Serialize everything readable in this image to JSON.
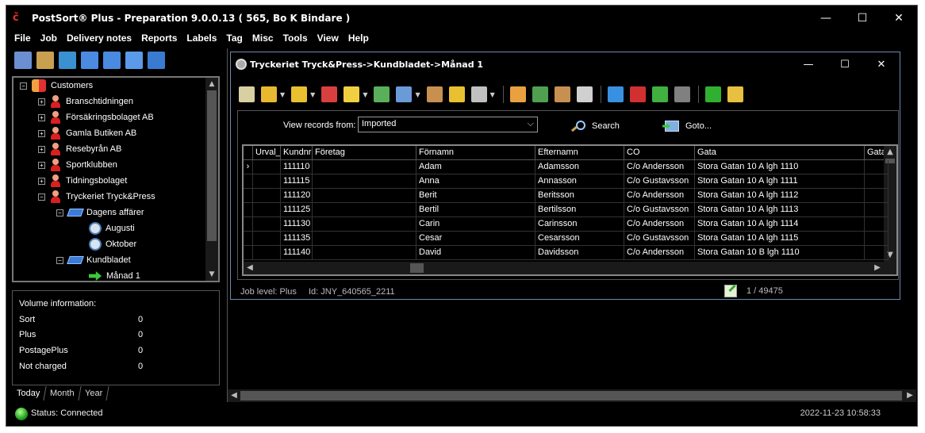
{
  "app": {
    "title": "PostSort® Plus - Preparation 9.0.0.13 ( 565, Bo K Bindare )",
    "logo_glyph": "ℂ"
  },
  "window_controls": {
    "minimize": "—",
    "maximize": "☐",
    "close": "✕"
  },
  "menu": [
    "File",
    "Job",
    "Delivery notes",
    "Reports",
    "Labels",
    "Tag",
    "Misc",
    "Tools",
    "View",
    "Help"
  ],
  "left_toolbar_icons": [
    {
      "name": "magnify-tools-icon",
      "color": "#6b8fd0"
    },
    {
      "name": "packages-icon",
      "color": "#c8a050"
    },
    {
      "name": "network-icon",
      "color": "#3a90d0"
    },
    {
      "name": "layout-columns-icon",
      "color": "#4a8ae0"
    },
    {
      "name": "layout-rows-icon",
      "color": "#4a8ae0"
    },
    {
      "name": "cascade-windows-icon",
      "color": "#5a9ae8"
    },
    {
      "name": "refresh-icon",
      "color": "#3a7ad0"
    }
  ],
  "tree": {
    "root": "Customers",
    "items": [
      {
        "label": "Branschtidningen"
      },
      {
        "label": "Försäkringsbolaget AB"
      },
      {
        "label": "Gamla Butiken AB"
      },
      {
        "label": "Resebyrån AB"
      },
      {
        "label": "Sportklubben"
      },
      {
        "label": "Tidningsbolaget"
      },
      {
        "label": "Tryckeriet Tryck&Press"
      }
    ],
    "sub1": "Dagens affärer",
    "sub1_children": [
      "Augusti",
      "Oktober"
    ],
    "sub2": "Kundbladet",
    "sub2_children": [
      "Månad 1"
    ],
    "expand_plus": "+",
    "expand_minus": "−"
  },
  "volume": {
    "title": "Volume information:",
    "rows": [
      {
        "label": "Sort",
        "value": "0"
      },
      {
        "label": "Plus",
        "value": "0"
      },
      {
        "label": "PostagePlus",
        "value": "0"
      },
      {
        "label": "Not charged",
        "value": "0"
      }
    ]
  },
  "tabs": [
    "Today",
    "Month",
    "Year"
  ],
  "status": {
    "text": "Status: Connected",
    "time": "2022-11-23 10:58:33"
  },
  "child": {
    "title": "Tryckeriet Tryck&Press->Kundbladet->Månad 1",
    "controls": {
      "minimize": "—",
      "maximize": "☐",
      "close": "✕"
    },
    "toolbar": [
      {
        "name": "edit-icon",
        "color": "#d8d0a0",
        "drop": false
      },
      {
        "name": "database-import-icon",
        "color": "#e8b830",
        "drop": true
      },
      {
        "name": "coins-icon",
        "color": "#e8c030",
        "drop": true
      },
      {
        "name": "pie-chart-icon",
        "color": "#d84040",
        "drop": false
      },
      {
        "name": "magic-wand-icon",
        "color": "#f0d040",
        "drop": true
      },
      {
        "name": "pen-write-icon",
        "color": "#5ab05a",
        "drop": false
      },
      {
        "name": "form-list-icon",
        "color": "#6a9ad8",
        "drop": true
      },
      {
        "name": "package-search-icon",
        "color": "#c89050",
        "drop": false
      },
      {
        "name": "database-filter-icon",
        "color": "#e8c030",
        "drop": false
      },
      {
        "name": "printer-icon",
        "color": "#c0c0c0",
        "drop": true
      },
      {
        "sep": true
      },
      {
        "name": "spreadsheet-icon",
        "color": "#e8a040",
        "drop": false
      },
      {
        "name": "gear-network-icon",
        "color": "#50a050",
        "drop": false
      },
      {
        "name": "package-export-icon",
        "color": "#c89050",
        "drop": false
      },
      {
        "name": "hand-icon",
        "color": "#d0d0d0",
        "drop": false
      },
      {
        "sep": true
      },
      {
        "name": "arrow-up-right-icon",
        "color": "#3a90e0",
        "drop": false
      },
      {
        "name": "delete-x-icon",
        "color": "#d03030",
        "drop": false
      },
      {
        "name": "checklist-icon",
        "color": "#40b040",
        "drop": false
      },
      {
        "name": "keyboard-icon",
        "color": "#808080",
        "drop": false
      },
      {
        "sep": true
      },
      {
        "name": "info-icon",
        "color": "#30b030",
        "drop": false
      },
      {
        "name": "folder-search-icon",
        "color": "#e8c040",
        "drop": false
      }
    ],
    "filter": {
      "label": "View records from:",
      "value": "Imported",
      "chevron": "⌵"
    },
    "search_label": "Search",
    "goto_label": "Goto...",
    "grid": {
      "columns": [
        "Urval_",
        "Kundnr",
        "Företag",
        "Förnamn",
        "Efternamn",
        "CO",
        "Gata",
        "Gata"
      ],
      "rows": [
        [
          "111110",
          "",
          "Adam",
          "Adamsson",
          "C/o Andersson",
          "Stora Gatan 10 A lgh 1110",
          ""
        ],
        [
          "111115",
          "",
          "Anna",
          "Annasson",
          "C/o Gustavsson",
          "Stora Gatan 10 A lgh 1111",
          ""
        ],
        [
          "111120",
          "",
          "Berit",
          "Beritsson",
          "C/o Andersson",
          "Stora Gatan 10 A lgh 1112",
          ""
        ],
        [
          "111125",
          "",
          "Bertil",
          "Bertilsson",
          "C/o Gustavsson",
          "Stora Gatan 10 A lgh 1113",
          ""
        ],
        [
          "111130",
          "",
          "Carin",
          "Carinsson",
          "C/o Andersson",
          "Stora Gatan 10 A lgh 1114",
          ""
        ],
        [
          "111135",
          "",
          "Cesar",
          "Cesarsson",
          "C/o Gustavsson",
          "Stora Gatan 10 A lgh 1115",
          ""
        ],
        [
          "111140",
          "",
          "David",
          "Davidsson",
          "C/o Andersson",
          "Stora Gatan 10 B lgh 1110",
          ""
        ]
      ],
      "current_row_indicator": "›"
    },
    "footer": {
      "job_level": "Job level: Plus",
      "id": "Id: JNY_640565_2211",
      "record_count": "1 / 49475"
    }
  }
}
